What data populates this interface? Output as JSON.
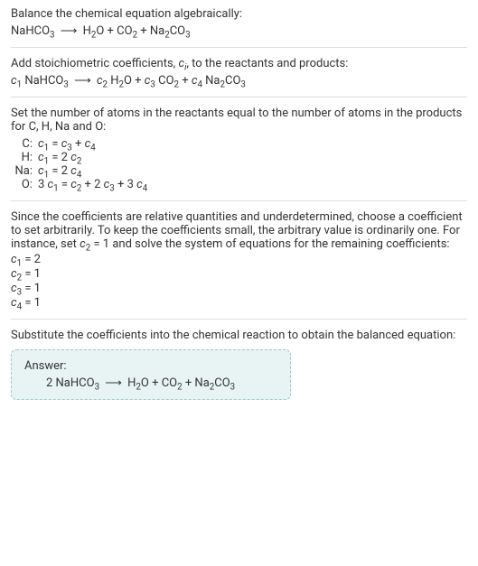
{
  "intro": {
    "line1": "Balance the chemical equation algebraically:",
    "reaction_lhs": "NaHCO",
    "reaction_sub1": "3",
    "reaction_rhs_h2o": "H",
    "reaction_sub2": "2",
    "reaction_o": "O + CO",
    "reaction_sub3": "2",
    "reaction_plus_na": " + Na",
    "reaction_sub4": "2",
    "reaction_co": "CO",
    "reaction_sub5": "3"
  },
  "step1": {
    "text_a": "Add stoichiometric coefficients, ",
    "ci": "c",
    "ci_sub": "i",
    "text_b": ", to the reactants and products:",
    "c1": "c",
    "s1": "1",
    "nahco": " NaHCO",
    "s1b": "3",
    "c2": "c",
    "s2": "2",
    "h2o": " H",
    "s2b": "2",
    "o_plus": "O + ",
    "c3": "c",
    "s3": "3",
    "co2": " CO",
    "s3b": "2",
    "plus2": " + ",
    "c4": "c",
    "s4": "4",
    "na2": " Na",
    "s4b": "2",
    "co3": "CO",
    "s4c": "3"
  },
  "step2": {
    "text": "Set the number of atoms in the reactants equal to the number of atoms in the products for C, H, Na and O:",
    "rows": [
      {
        "label": "C:",
        "lhs": "c",
        "lhs_sub": "1",
        "eq": " = ",
        "r1": "c",
        "r1s": "3",
        "plus": " + ",
        "r2": "c",
        "r2s": "4"
      },
      {
        "label": "H:",
        "lhs": "c",
        "lhs_sub": "1",
        "eq": " = 2 ",
        "r1": "c",
        "r1s": "2",
        "plus": "",
        "r2": "",
        "r2s": ""
      },
      {
        "label": "Na:",
        "lhs": "c",
        "lhs_sub": "1",
        "eq": " = 2 ",
        "r1": "c",
        "r1s": "4",
        "plus": "",
        "r2": "",
        "r2s": ""
      },
      {
        "label": "O:",
        "lhs_pre": "3 ",
        "lhs": "c",
        "lhs_sub": "1",
        "eq": " = ",
        "r1": "c",
        "r1s": "2",
        "plus": " + 2 ",
        "r2": "c",
        "r2s": "3",
        "plus2": " + 3 ",
        "r3": "c",
        "r3s": "4"
      }
    ]
  },
  "step3": {
    "text_a": "Since the coefficients are relative quantities and underdetermined, choose a coefficient to set arbitrarily. To keep the coefficients small, the arbitrary value is ordinarily one. For instance, set ",
    "c2": "c",
    "c2s": "2",
    "text_b": " = 1 and solve the system of equations for the remaining coefficients:",
    "lines": [
      {
        "c": "c",
        "cs": "1",
        "val": " = 2"
      },
      {
        "c": "c",
        "cs": "2",
        "val": " = 1"
      },
      {
        "c": "c",
        "cs": "3",
        "val": " = 1"
      },
      {
        "c": "c",
        "cs": "4",
        "val": " = 1"
      }
    ]
  },
  "step4": {
    "text": "Substitute the coefficients into the chemical reaction to obtain the balanced equation:"
  },
  "answer": {
    "title": "Answer:",
    "two": "2 NaHCO",
    "s1": "3",
    "h2o": "H",
    "s2": "2",
    "o_plus": "O + CO",
    "s3": "2",
    "plus_na": " + Na",
    "s4": "2",
    "co3": "CO",
    "s5": "3"
  },
  "arrow": "⟶"
}
